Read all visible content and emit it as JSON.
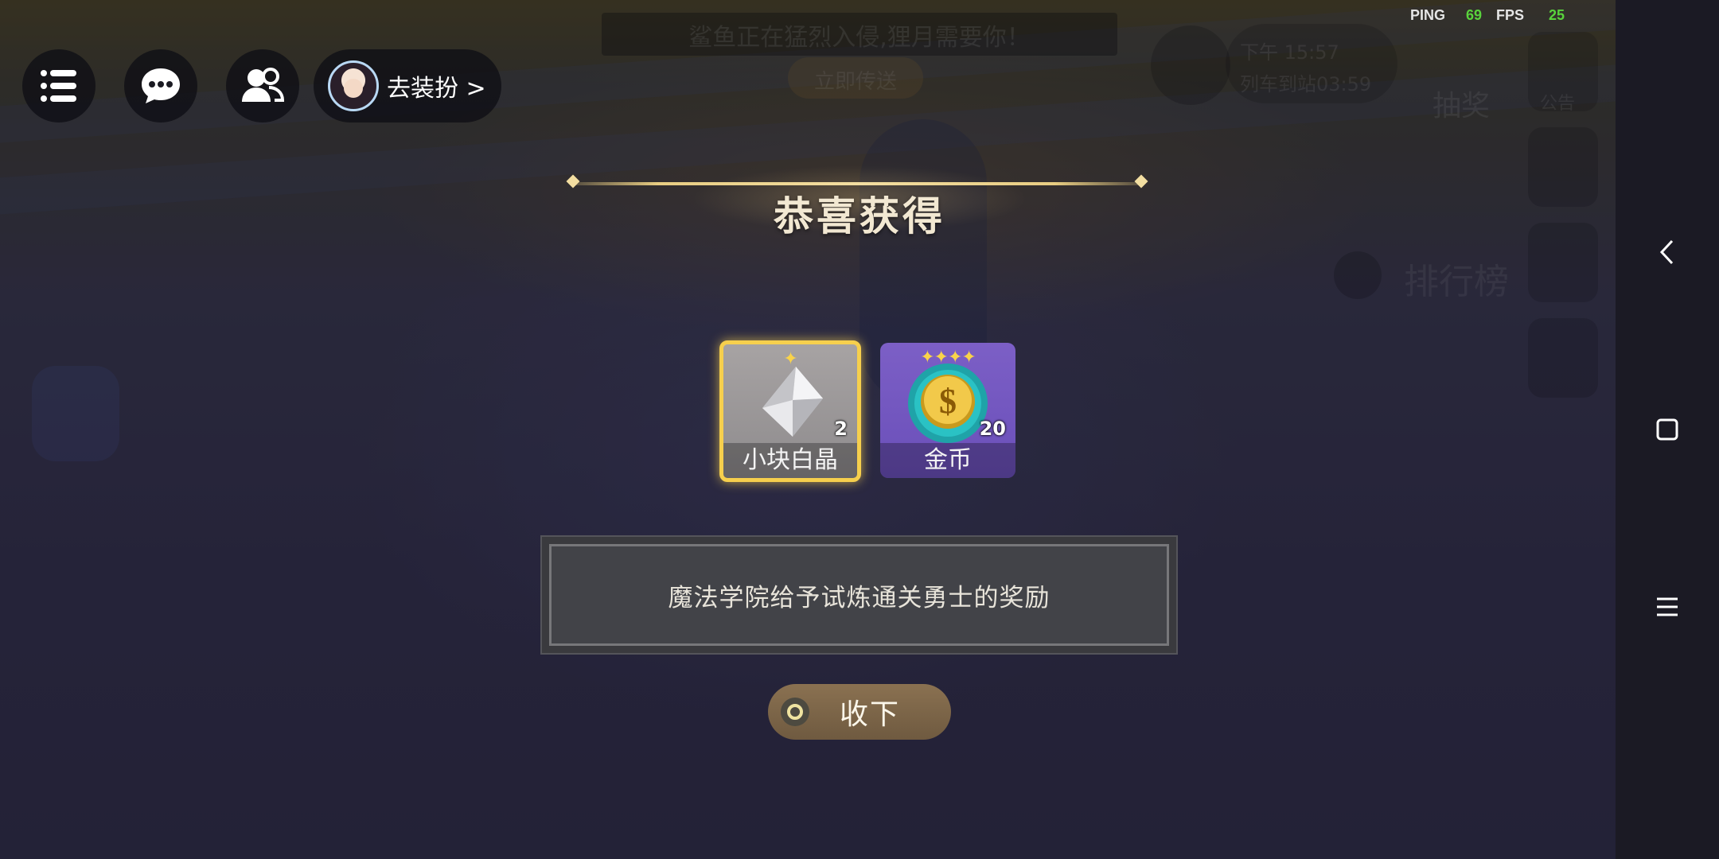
{
  "background": {
    "banner_text": "鲨鱼正在猛烈入侵,狸月需要你！",
    "banner_button": "立即传送",
    "clock_time": "下午 15:57",
    "train_text": "列车到站03:59",
    "lottery_label": "抽奖",
    "notice_label": "公告",
    "ranking_label": "排行榜"
  },
  "hud": {
    "dress_label": "去装扮 >",
    "ping_label": "PING",
    "ping_value": "69",
    "fps_label": "FPS",
    "fps_value": "25"
  },
  "dialog": {
    "title": "恭喜获得",
    "items": [
      {
        "name": "小块白晶",
        "count": "2",
        "stars": "✦",
        "icon": "crystal-icon"
      },
      {
        "name": "金币",
        "count": "20",
        "stars": "✦✦✦✦",
        "icon": "coin-icon"
      }
    ],
    "description": "魔法学院给予试炼通关勇士的奖励",
    "collect_button": "收下"
  },
  "colors": {
    "highlight_border": "#f6cf4d",
    "ping_color": "#59d33c",
    "fps_color": "#59d33c",
    "title_line": "#e8cd82"
  }
}
